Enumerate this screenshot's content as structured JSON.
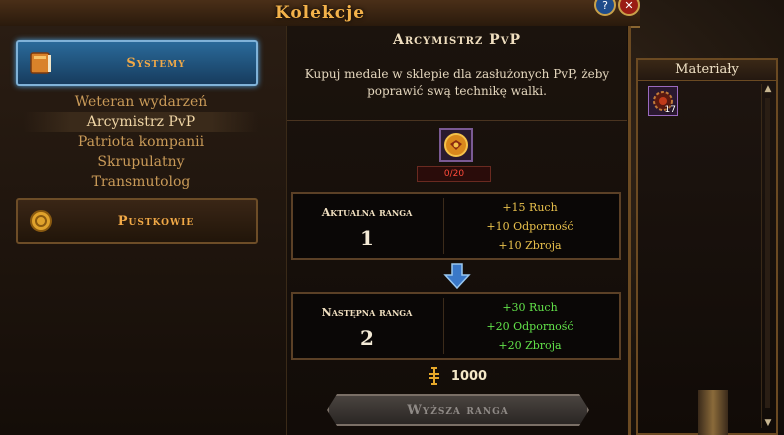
{
  "window": {
    "title": "Kolekcje",
    "help_label": "?",
    "close_label": "✕"
  },
  "categories": [
    {
      "label": "Systemy",
      "icon": "book-icon",
      "active": true
    },
    {
      "label": "Pustkowie",
      "icon": "coin-icon",
      "active": false
    }
  ],
  "subcategories": [
    {
      "label": "Weteran wydarzeń",
      "selected": false
    },
    {
      "label": "Arcymistrz PvP",
      "selected": true
    },
    {
      "label": "Patriota kompanii",
      "selected": false
    },
    {
      "label": "Skrupulatny",
      "selected": false
    },
    {
      "label": "Transmutolog",
      "selected": false
    }
  ],
  "achievement": {
    "title": "Arcymistrz PvP",
    "description": "Kupuj medale w sklepie dla zasłużonych PvP, żeby poprawić swą technikę walki.",
    "progress": "0/20",
    "medal_icon": "medal-icon"
  },
  "current_rank": {
    "label": "Aktualna ranga",
    "number": "1",
    "bonuses": [
      "+15 Ruch",
      "+10 Odporność",
      "+10 Zbroja"
    ]
  },
  "next_rank": {
    "label": "Następna ranga",
    "number": "2",
    "bonuses": [
      "+30 Ruch",
      "+20 Odporność",
      "+20 Zbroja"
    ]
  },
  "cost": {
    "currency_icon": "currency-icon",
    "value": "1000"
  },
  "rankup_button": "Wyższa ranga",
  "materials": {
    "title": "Materiały",
    "items": [
      {
        "icon": "gear-medal-icon",
        "count": "17"
      }
    ]
  },
  "colors": {
    "accent_orange": "#f1a947",
    "active_blue": "#2a6a9a",
    "bonus_current": "#e8c04c",
    "bonus_next": "#62e24a",
    "progress_red": "#ff4a3a"
  }
}
